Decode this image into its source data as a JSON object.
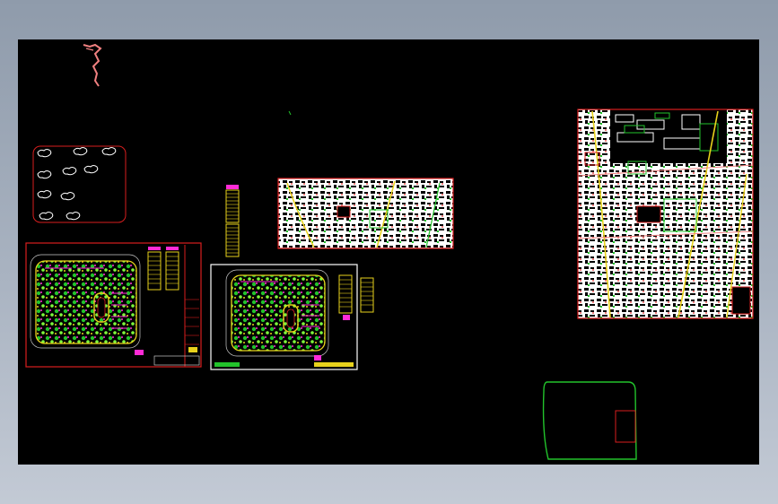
{
  "window": {
    "title": ""
  },
  "viewport": {
    "background": "#000000",
    "frame_gradient": [
      "#8f9bab",
      "#c3cad5"
    ]
  },
  "colors": {
    "red": "#d81e1e",
    "green": "#22c32b",
    "magenta": "#ff2bd6",
    "yellow": "#e8d21c",
    "white": "#ffffff",
    "salmon": "#f08080",
    "lime": "#7dfc3c",
    "gray": "#c9c9c9"
  },
  "drawings": [
    {
      "id": "river-sketch",
      "kind": "sketch"
    },
    {
      "id": "tree-symbol-sheet",
      "kind": "symbol-legend"
    },
    {
      "id": "site-plan-1",
      "kind": "site-plan"
    },
    {
      "id": "site-plan-2",
      "kind": "site-plan"
    },
    {
      "id": "area-table-strip",
      "kind": "table"
    },
    {
      "id": "aerial-map-small",
      "kind": "map"
    },
    {
      "id": "aerial-map-large",
      "kind": "map"
    },
    {
      "id": "site-outline",
      "kind": "boundary"
    }
  ]
}
